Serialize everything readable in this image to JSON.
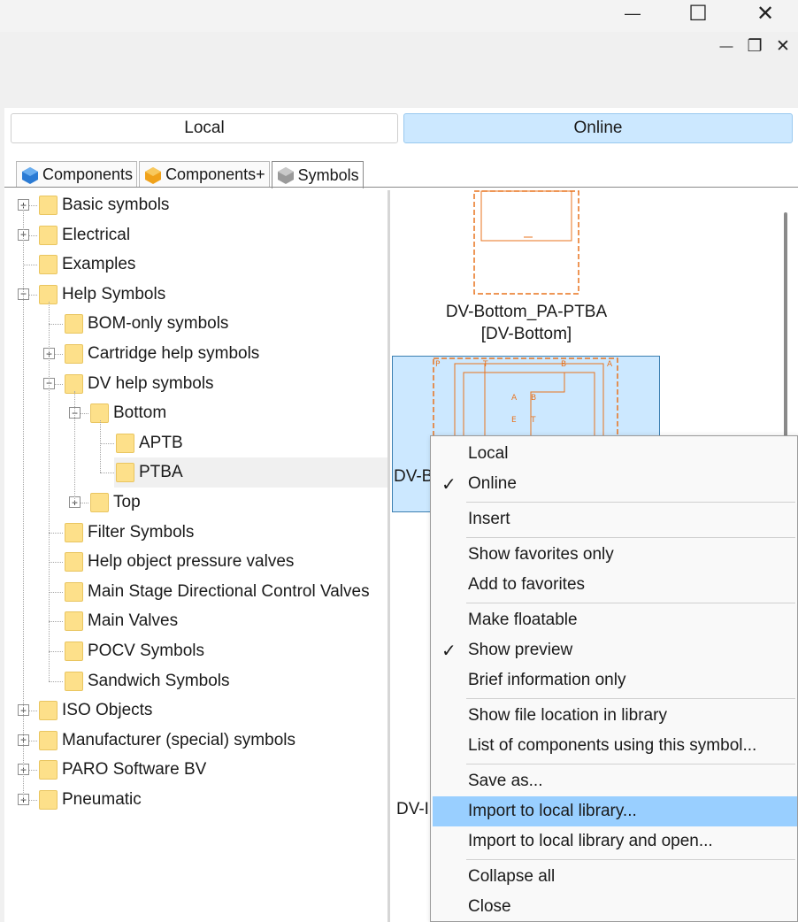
{
  "window": {
    "minimize_glyph": "—",
    "maximize_glyph": "☐",
    "close_glyph": "✕",
    "sub_minimize_glyph": "—",
    "sub_restore_glyph": "❐",
    "sub_close_glyph": "✕"
  },
  "toggle": {
    "local_label": "Local",
    "online_label": "Online"
  },
  "tabs": [
    {
      "label": "Components",
      "icon": "cube-blue-icon",
      "color": "#2b7bd4"
    },
    {
      "label": "Components+",
      "icon": "cube-orange-icon",
      "color": "#f0a21a"
    },
    {
      "label": "Symbols",
      "icon": "cube-gray-icon",
      "color": "#9a9a9a"
    }
  ],
  "tree": {
    "items": [
      {
        "label": "Basic symbols",
        "level": 0,
        "expander": "plus"
      },
      {
        "label": "Electrical",
        "level": 0,
        "expander": "plus"
      },
      {
        "label": "Examples",
        "level": 0,
        "expander": "none"
      },
      {
        "label": "Help Symbols",
        "level": 0,
        "expander": "minus"
      },
      {
        "label": "BOM-only symbols",
        "level": 1,
        "expander": "none"
      },
      {
        "label": "Cartridge help symbols",
        "level": 1,
        "expander": "plus"
      },
      {
        "label": "DV help symbols",
        "level": 1,
        "expander": "minus"
      },
      {
        "label": "Bottom",
        "level": 2,
        "expander": "minus"
      },
      {
        "label": "APTB",
        "level": 3,
        "expander": "none"
      },
      {
        "label": "PTBA",
        "level": 3,
        "expander": "none",
        "selected": true
      },
      {
        "label": "Top",
        "level": 2,
        "expander": "plus"
      },
      {
        "label": "Filter Symbols",
        "level": 1,
        "expander": "none"
      },
      {
        "label": "Help object pressure valves",
        "level": 1,
        "expander": "none"
      },
      {
        "label": "Main Stage Directional Control Valves",
        "level": 1,
        "expander": "none"
      },
      {
        "label": "Main Valves",
        "level": 1,
        "expander": "none"
      },
      {
        "label": "POCV Symbols",
        "level": 1,
        "expander": "none"
      },
      {
        "label": "Sandwich Symbols",
        "level": 1,
        "expander": "none"
      },
      {
        "label": "ISO Objects",
        "level": 0,
        "expander": "plus"
      },
      {
        "label": "Manufacturer (special) symbols",
        "level": 0,
        "expander": "plus"
      },
      {
        "label": "PARO Software BV",
        "level": 0,
        "expander": "plus"
      },
      {
        "label": "Pneumatic",
        "level": 0,
        "expander": "plus"
      }
    ]
  },
  "symbols": {
    "first_caption_line1": "DV-Bottom_PA-PTBA",
    "first_caption_line2": "[DV-Bottom]",
    "second_caption_partial": "DV-B",
    "third_caption_partial": "DV-I",
    "second_labels": [
      "P",
      "T",
      "B",
      "A",
      "A",
      "B",
      "E",
      "T"
    ],
    "symbol_color": "#e8731e"
  },
  "context_menu": {
    "items": [
      {
        "label": "Local",
        "checked": false
      },
      {
        "label": "Online",
        "checked": true
      },
      {
        "sep": true
      },
      {
        "label": "Insert"
      },
      {
        "sep": true
      },
      {
        "label": "Show favorites only"
      },
      {
        "label": "Add to favorites"
      },
      {
        "sep": true
      },
      {
        "label": "Make floatable"
      },
      {
        "label": "Show preview",
        "checked": true
      },
      {
        "label": "Brief information only"
      },
      {
        "sep": true
      },
      {
        "label": "Show file location in library"
      },
      {
        "label": "List of components using this symbol..."
      },
      {
        "sep": true
      },
      {
        "label": "Save as..."
      },
      {
        "label": "Import to local library...",
        "highlighted": true
      },
      {
        "label": "Import to local library and open..."
      },
      {
        "sep": true
      },
      {
        "label": "Collapse all"
      },
      {
        "label": "Close"
      }
    ],
    "check_glyph": "✓",
    "highlight_color": "#99cfff"
  }
}
